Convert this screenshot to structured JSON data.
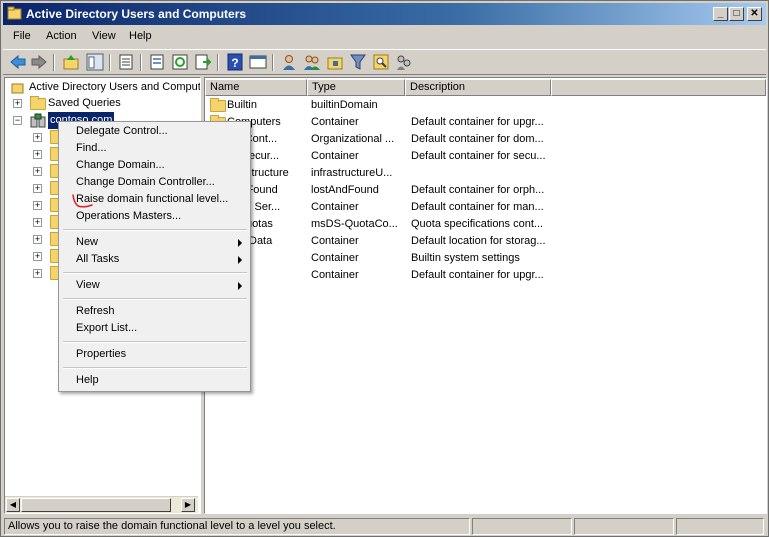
{
  "window": {
    "title": "Active Directory Users and Computers",
    "minimize": "_",
    "maximize": "□",
    "close": "✕"
  },
  "menubar": [
    "File",
    "Action",
    "View",
    "Help"
  ],
  "toolbar": {
    "icons": [
      "back-icon",
      "forward-icon",
      "up-level-icon",
      "show-hide-tree-icon",
      "properties-icon",
      "export-list-icon",
      "refresh-icon",
      "export-icon",
      "help-icon",
      "console-icon",
      "new-user-icon",
      "new-group-icon",
      "new-ou-icon",
      "filter-icon",
      "find-icon",
      "add-to-group-icon"
    ]
  },
  "tree": {
    "root": "Active Directory Users and Computers",
    "saved_queries": "Saved Queries",
    "domain": "contoso.com",
    "child_count": 9
  },
  "list": {
    "columns": [
      "Name",
      "Type",
      "Description"
    ],
    "rows": [
      {
        "name": "Builtin",
        "type": "builtinDomain",
        "description": ""
      },
      {
        "name": "Computers",
        "type": "Container",
        "description": "Default container for upgr..."
      },
      {
        "name": "ain Cont...",
        "type": "Organizational ...",
        "description": "Default container for dom..."
      },
      {
        "name": "ignSecur...",
        "type": "Container",
        "description": "Default container for secu..."
      },
      {
        "name": "nfrastructure",
        "type": "infrastructureU...",
        "description": ""
      },
      {
        "name": "AndFound",
        "type": "lostAndFound",
        "description": "Default container for orph..."
      },
      {
        "name": "aged Ser...",
        "type": "Container",
        "description": "Default container for man..."
      },
      {
        "name": "S Quotas",
        "type": "msDS-QuotaCo...",
        "description": "Quota specifications cont..."
      },
      {
        "name": "ram Data",
        "type": "Container",
        "description": "Default location for storag..."
      },
      {
        "name": "em",
        "type": "Container",
        "description": "Builtin system settings"
      },
      {
        "name": "s",
        "type": "Container",
        "description": "Default container for upgr..."
      }
    ]
  },
  "context_menu": {
    "items": [
      "Delegate Control...",
      "Find...",
      "Change Domain...",
      "Change Domain Controller...",
      "Raise domain functional level...",
      "Operations Masters...",
      "New",
      "All Tasks",
      "View",
      "Refresh",
      "Export List...",
      "Properties",
      "Help"
    ],
    "annotation_color": "#e02020"
  },
  "statusbar": {
    "text": "Allows you to raise the domain functional level to a level you select."
  },
  "colors": {
    "selection": "#0a246a",
    "folder": "#f4d46b"
  }
}
